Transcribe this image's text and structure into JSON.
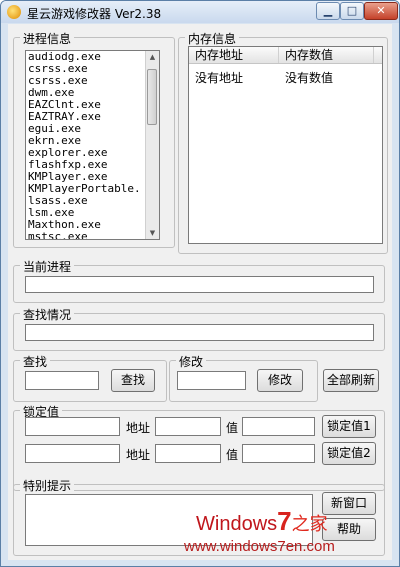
{
  "window": {
    "title": "星云游戏修改器 Ver2.38"
  },
  "titlebar_buttons": {
    "minimize_glyph": "▁",
    "maximize_glyph": "□",
    "close_glyph": "✕"
  },
  "process_group": {
    "label": "进程信息",
    "items": [
      "audiodg.exe",
      "csrss.exe",
      "csrss.exe",
      "dwm.exe",
      "EAZClnt.exe",
      "EAZTRAY.exe",
      "egui.exe",
      "ekrn.exe",
      "explorer.exe",
      "flashfxp.exe",
      "KMPlayer.exe",
      "KMPlayerPortable.",
      "lsass.exe",
      "lsm.exe",
      "Maxthon.exe",
      "mstsc.exe"
    ]
  },
  "memory_group": {
    "label": "内存信息",
    "columns": [
      "内存地址",
      "内存数值"
    ],
    "rows": [
      [
        "没有地址",
        "没有数值"
      ]
    ]
  },
  "current_process": {
    "label": "当前进程",
    "value": ""
  },
  "search_status": {
    "label": "查找情况",
    "value": ""
  },
  "search": {
    "label": "查找",
    "value": "",
    "button": "查找"
  },
  "modify": {
    "label": "修改",
    "value": "",
    "button": "修改"
  },
  "refresh_all_button": "全部刷新",
  "lock": {
    "label": "锁定值",
    "address_label": "地址",
    "value_label": "值",
    "rows": [
      {
        "name": "",
        "address": "",
        "value": "",
        "button": "锁定值1"
      },
      {
        "name": "",
        "address": "",
        "value": "",
        "button": "锁定值2"
      }
    ]
  },
  "special_tips": {
    "label": "特别提示",
    "text": ""
  },
  "new_window_button": "新窗口",
  "help_button": "帮助",
  "watermark": {
    "brand_a": "Windows",
    "brand_num": "7",
    "brand_cn": "之家",
    "url": "www.windows7en.com"
  }
}
